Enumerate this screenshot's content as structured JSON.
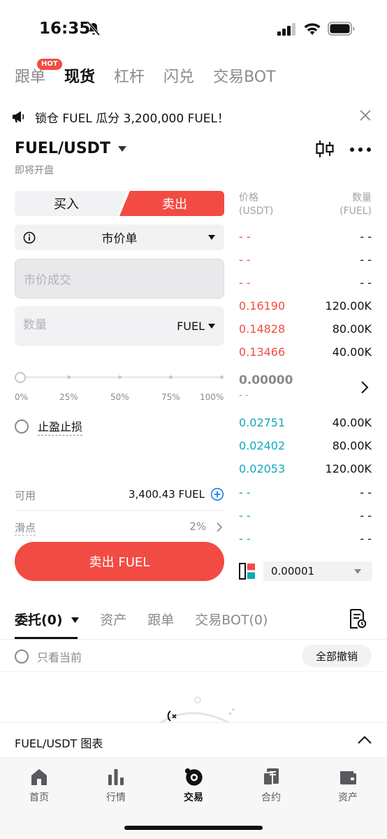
{
  "status_bar": {
    "time": "16:35"
  },
  "top_tabs": [
    {
      "label": "跟单",
      "badge": "HOT",
      "active": false
    },
    {
      "label": "现货",
      "active": true
    },
    {
      "label": "杠杆",
      "active": false
    },
    {
      "label": "闪兑",
      "active": false
    },
    {
      "label": "交易BOT",
      "active": false
    }
  ],
  "banner": {
    "text": "锁仓 FUEL 瓜分 3,200,000 FUEL！"
  },
  "pair": {
    "symbol": "FUEL/USDT",
    "status": "即将开盘"
  },
  "order_form": {
    "buy_label": "买入",
    "sell_label": "卖出",
    "order_type": "市价单",
    "price_placeholder": "市价成交",
    "qty_placeholder": "数量",
    "qty_unit": "FUEL",
    "slider_percent": 0,
    "slider_ticks": [
      "0%",
      "25%",
      "50%",
      "75%",
      "100%"
    ],
    "tpsl_label": "止盈止损",
    "available_label": "可用",
    "available_value": "3,400.43 FUEL",
    "slippage_label": "滑点",
    "slippage_value": "2%",
    "submit_label": "卖出 FUEL"
  },
  "order_book": {
    "price_header": "价格",
    "price_unit": "(USDT)",
    "qty_header": "数量",
    "qty_unit": "(FUEL)",
    "asks": [
      {
        "price": "- -",
        "qty": "- -"
      },
      {
        "price": "- -",
        "qty": "- -"
      },
      {
        "price": "- -",
        "qty": "- -"
      },
      {
        "price": "0.16190",
        "qty": "120.00K"
      },
      {
        "price": "0.14828",
        "qty": "80.00K"
      },
      {
        "price": "0.13466",
        "qty": "40.00K"
      }
    ],
    "last_price": "0.00000",
    "last_sub": "- -",
    "bids": [
      {
        "price": "0.02751",
        "qty": "40.00K"
      },
      {
        "price": "0.02402",
        "qty": "80.00K"
      },
      {
        "price": "0.02053",
        "qty": "120.00K"
      },
      {
        "price": "- -",
        "qty": "- -"
      },
      {
        "price": "- -",
        "qty": "- -"
      },
      {
        "price": "- -",
        "qty": "- -"
      }
    ],
    "precision": "0.00001"
  },
  "bottom_tabs": [
    {
      "label": "委托(0)",
      "active": true
    },
    {
      "label": "资产",
      "active": false
    },
    {
      "label": "跟单",
      "active": false
    },
    {
      "label": "交易BOT(0)",
      "active": false
    }
  ],
  "orders": {
    "only_current_label": "只看当前",
    "cancel_all_label": "全部撤销"
  },
  "chart_bar": {
    "label": "FUEL/USDT  图表"
  },
  "tab_bar": [
    {
      "label": "首页",
      "icon": "home-icon",
      "active": false
    },
    {
      "label": "行情",
      "icon": "market-icon",
      "active": false
    },
    {
      "label": "交易",
      "icon": "trade-icon",
      "active": true
    },
    {
      "label": "合约",
      "icon": "futures-icon",
      "active": false
    },
    {
      "label": "资产",
      "icon": "wallet-icon",
      "active": false
    }
  ],
  "colors": {
    "sell_red": "#f24b43",
    "buy_teal": "#12a8b8",
    "muted": "#8a8a8e"
  }
}
